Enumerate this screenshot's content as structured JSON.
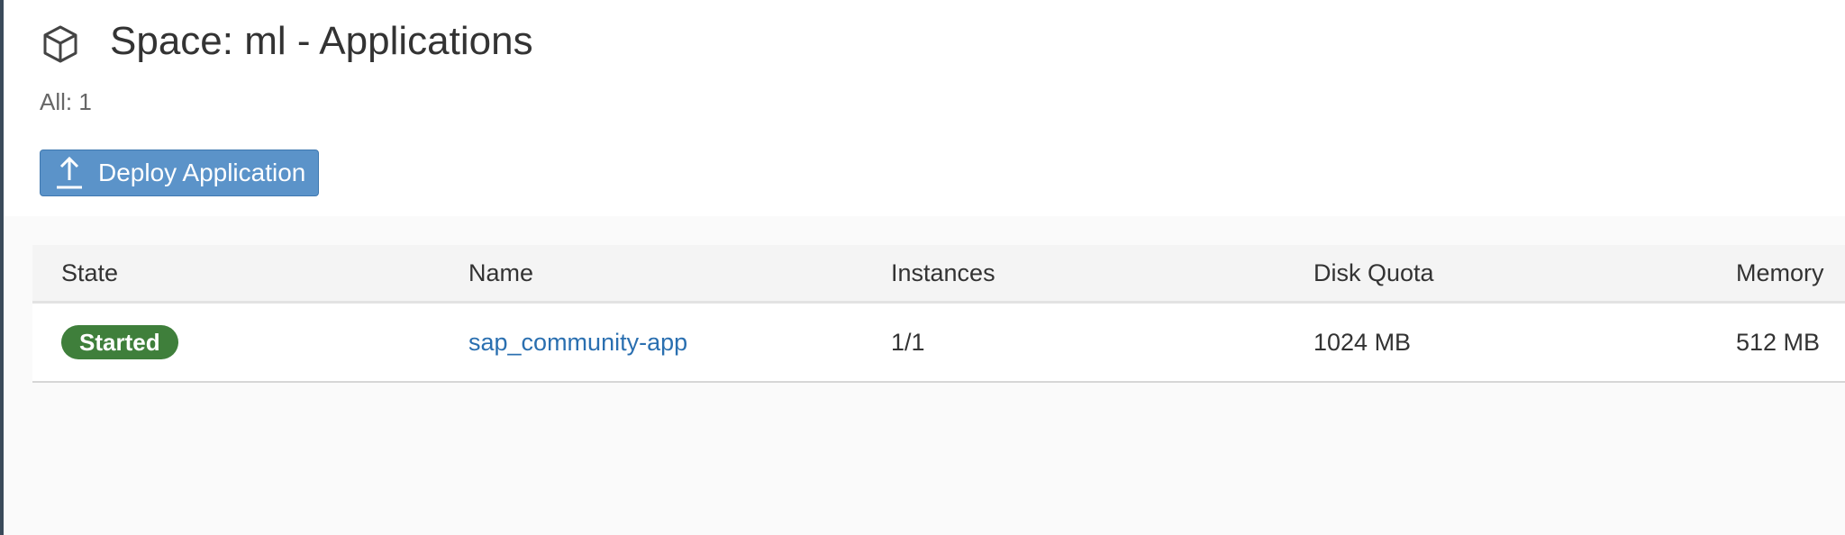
{
  "header": {
    "title": "Space: ml - Applications",
    "count_text": "All: 1",
    "icon": "space-cube-icon"
  },
  "toolbar": {
    "deploy_label": "Deploy Application",
    "deploy_icon": "upload-icon"
  },
  "table": {
    "columns": [
      "State",
      "Name",
      "Instances",
      "Disk Quota",
      "Memory"
    ],
    "rows": [
      {
        "state": "Started",
        "name": "sap_community-app",
        "instances": "1/1",
        "disk_quota": "1024 MB",
        "memory": "512 MB"
      }
    ]
  },
  "colors": {
    "accent": "#5b93c9",
    "status_started": "#3f7f3b",
    "link": "#2a6fb0"
  }
}
